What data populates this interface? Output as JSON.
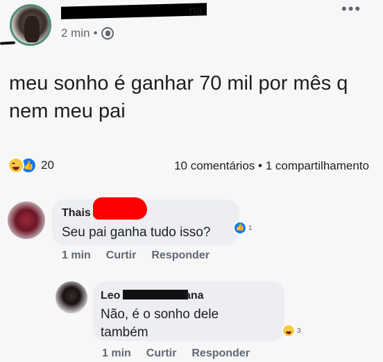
{
  "post": {
    "author_name_visible": "na",
    "time": "2 min",
    "separator": "•",
    "text": "meu sonho é ganhar 70 mil por mês q nem meu pai",
    "reaction_count": "20",
    "comments_shares": "10 comentários • 1 compartilhamento",
    "more_label": "•••"
  },
  "comments": [
    {
      "name": "Thais",
      "text": "Seu pai ganha tudo isso?",
      "reaction_count": "1",
      "time": "1 min",
      "like_label": "Curtir",
      "reply_label": "Responder"
    },
    {
      "name_start": "Leo",
      "name_end": "ana",
      "text": "Não, é o sonho dele também",
      "reaction_count": "3",
      "time": "1 min",
      "like_label": "Curtir",
      "reply_label": "Responder"
    }
  ],
  "colors": {
    "background": "#f7f7f8",
    "bubble": "#eceef1",
    "secondary_text": "#606770",
    "like_blue": "#1877f2",
    "haha_yellow": "#f7c948",
    "redaction_red": "#ff0000"
  },
  "icons": [
    "haha-reaction-icon",
    "like-reaction-icon",
    "globe-icon",
    "more-options-icon"
  ]
}
